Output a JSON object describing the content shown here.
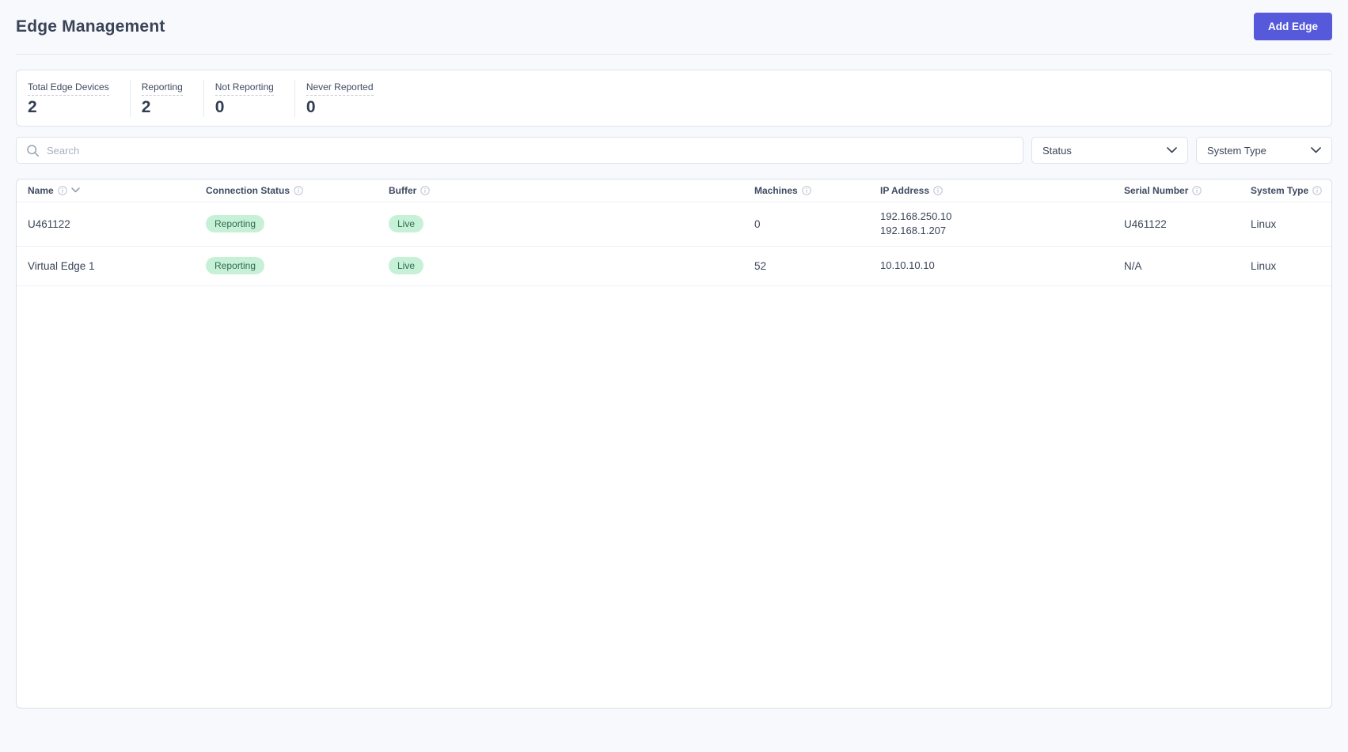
{
  "header": {
    "title": "Edge Management",
    "add_button_label": "Add Edge"
  },
  "stats": {
    "items": [
      {
        "label": "Total Edge Devices",
        "value": "2"
      },
      {
        "label": "Reporting",
        "value": "2"
      },
      {
        "label": "Not Reporting",
        "value": "0"
      },
      {
        "label": "Never Reported",
        "value": "0"
      }
    ]
  },
  "search": {
    "placeholder": "Search"
  },
  "filters": {
    "status_label": "Status",
    "system_type_label": "System Type"
  },
  "table": {
    "columns": [
      {
        "label": "Name"
      },
      {
        "label": "Connection Status"
      },
      {
        "label": "Buffer"
      },
      {
        "label": "Machines"
      },
      {
        "label": "IP Address"
      },
      {
        "label": "Serial Number"
      },
      {
        "label": "System Type"
      }
    ],
    "rows": [
      {
        "name": "U461122",
        "connection_status": "Reporting",
        "buffer": "Live",
        "machines": "0",
        "ip_addresses": [
          "192.168.250.10",
          "192.168.1.207"
        ],
        "serial_number": "U461122",
        "system_type": "Linux"
      },
      {
        "name": "Virtual Edge 1",
        "connection_status": "Reporting",
        "buffer": "Live",
        "machines": "52",
        "ip_addresses": [
          "10.10.10.10"
        ],
        "serial_number": "N/A",
        "system_type": "Linux"
      }
    ]
  },
  "colors": {
    "accent": "#5559da",
    "badge_background": "#c7f1d7",
    "badge_text": "#2f6b52",
    "page_background": "#f7f9fc"
  }
}
